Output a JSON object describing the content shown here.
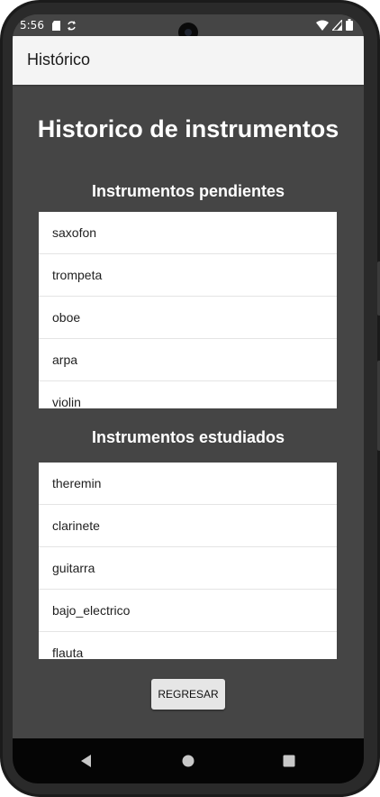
{
  "status_bar": {
    "time": "5:56",
    "left_icons": [
      "sd-card-icon",
      "sync-icon"
    ],
    "right_icons": [
      "wifi-icon",
      "cell-signal-icon",
      "battery-icon"
    ]
  },
  "app_bar": {
    "title": "Histórico"
  },
  "main": {
    "title": "Historico de instrumentos",
    "pending": {
      "title": "Instrumentos pendientes",
      "items": [
        "saxofon",
        "trompeta",
        "oboe",
        "arpa",
        "violin"
      ]
    },
    "studied": {
      "title": "Instrumentos estudiados",
      "items": [
        "theremin",
        "clarinete",
        "guitarra",
        "bajo_electrico",
        "flauta"
      ]
    },
    "back_button": "REGRESAR"
  },
  "nav_bar": {
    "buttons": [
      "back-icon",
      "home-icon",
      "recents-icon"
    ]
  },
  "colors": {
    "content_bg": "#454545",
    "app_bar_bg": "#f4f4f4",
    "list_bg": "#ffffff",
    "button_bg": "#e6e6e6",
    "nav_bg": "#050505"
  }
}
